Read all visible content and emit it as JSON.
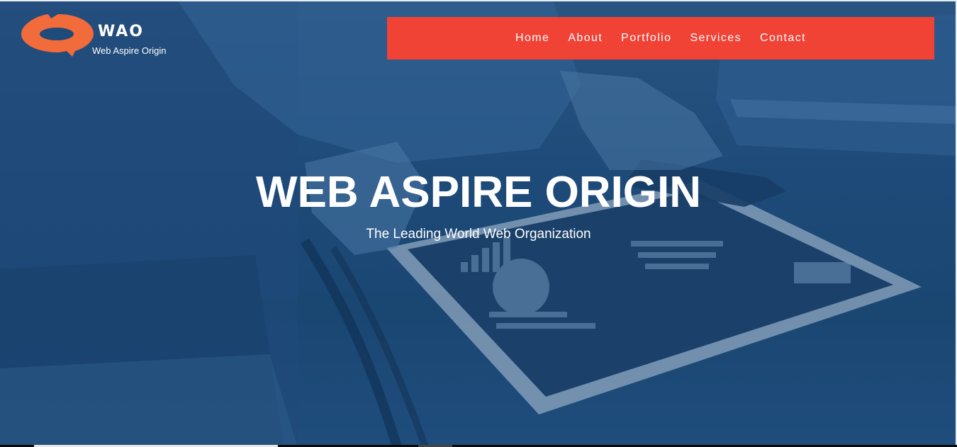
{
  "brand": {
    "logo_icon": "orange-swirl-logo-icon",
    "logo_color": "#f26b3a",
    "short_name": "WAO",
    "full_name": "Web Aspire Origin"
  },
  "nav": {
    "background": "#f14236",
    "items": [
      {
        "label": "Home"
      },
      {
        "label": "About"
      },
      {
        "label": "Portfolio"
      },
      {
        "label": "Services"
      },
      {
        "label": "Contact"
      }
    ]
  },
  "hero": {
    "title": "WEB ASPIRE ORIGIN",
    "tagline": "The Leading World Web Organization",
    "overlay_color": "#1d4a78"
  }
}
